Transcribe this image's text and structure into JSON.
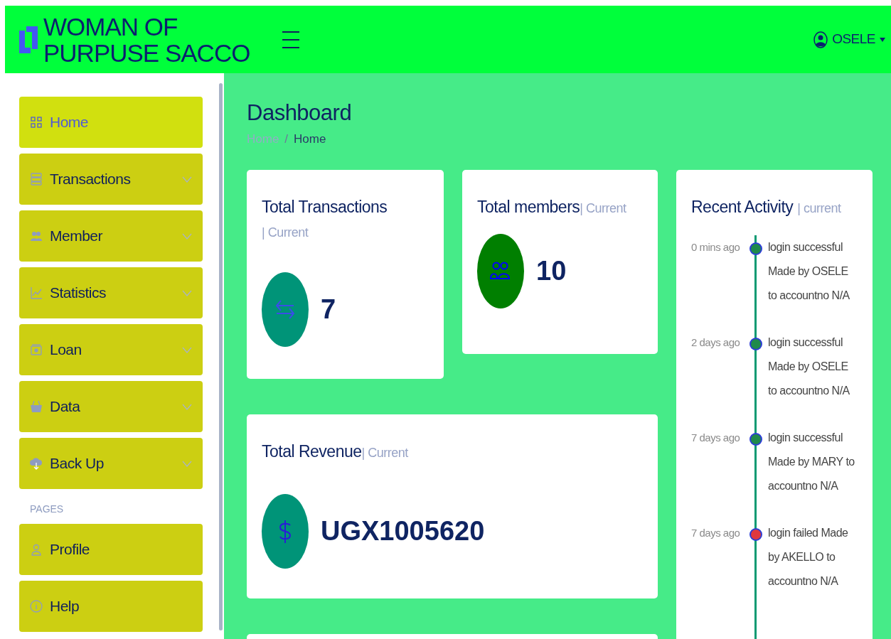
{
  "header": {
    "brand": [
      "WOMAN OF",
      "PURPUSE SACCO"
    ],
    "user": "OSELE"
  },
  "sidebar": {
    "items": [
      {
        "label": "Home",
        "selected": true,
        "expandable": false
      },
      {
        "label": "Transactions",
        "selected": false,
        "expandable": true
      },
      {
        "label": "Member",
        "selected": false,
        "expandable": true
      },
      {
        "label": "Statistics",
        "selected": false,
        "expandable": true
      },
      {
        "label": "Loan",
        "selected": false,
        "expandable": true
      },
      {
        "label": "Data",
        "selected": false,
        "expandable": true
      },
      {
        "label": "Back Up",
        "selected": false,
        "expandable": true
      }
    ],
    "section": "PAGES",
    "pages": [
      {
        "label": "Profile",
        "selected": false
      },
      {
        "label": "Help",
        "selected": false
      }
    ]
  },
  "page": {
    "title": "Dashboard",
    "breadcrumb": [
      "Home",
      "Home"
    ],
    "separator": "/"
  },
  "cards": [
    {
      "title": "Total Transactions",
      "subtitle": "| Current",
      "value": "7",
      "color": "#009478"
    },
    {
      "title": "Total members",
      "subtitle": "| Current",
      "value": "10",
      "color": "#007f00"
    },
    {
      "title": "Total Revenue",
      "subtitle": "| Current",
      "value": "UGX1005620",
      "color": "#009478"
    }
  ],
  "activity": {
    "title": "Recent Activity",
    "subtitle": "| current",
    "items": [
      {
        "time": "0 mins ago",
        "text": "login successful Made by OSELE to accountno N/A",
        "color": "#1f8a4c"
      },
      {
        "time": "2 days ago",
        "text": "login successful Made by OSELE to accountno N/A",
        "color": "#1f8a4c"
      },
      {
        "time": "7 days ago",
        "text": "login successful Made by MARY to accountno N/A",
        "color": "#1f8a4c"
      },
      {
        "time": "7 days ago",
        "text": "login failed Made by AKELLO to accountno N/A",
        "color": "#e0383e"
      }
    ]
  }
}
